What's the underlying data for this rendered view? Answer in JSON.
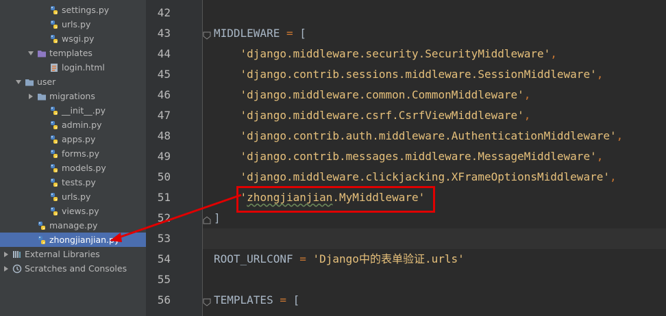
{
  "project_tree": {
    "items": [
      {
        "label": "settings.py",
        "type": "py",
        "indent": 3
      },
      {
        "label": "urls.py",
        "type": "py",
        "indent": 3
      },
      {
        "label": "wsgi.py",
        "type": "py",
        "indent": 3
      },
      {
        "label": "templates",
        "type": "folder-open",
        "indent": 2
      },
      {
        "label": "login.html",
        "type": "html",
        "indent": 3
      },
      {
        "label": "user",
        "type": "folder-open",
        "indent": 1
      },
      {
        "label": "migrations",
        "type": "folder-closed",
        "indent": 2
      },
      {
        "label": "__init__.py",
        "type": "py",
        "indent": 3
      },
      {
        "label": "admin.py",
        "type": "py",
        "indent": 3
      },
      {
        "label": "apps.py",
        "type": "py",
        "indent": 3
      },
      {
        "label": "forms.py",
        "type": "py",
        "indent": 3
      },
      {
        "label": "models.py",
        "type": "py",
        "indent": 3
      },
      {
        "label": "tests.py",
        "type": "py",
        "indent": 3
      },
      {
        "label": "urls.py",
        "type": "py",
        "indent": 3
      },
      {
        "label": "views.py",
        "type": "py",
        "indent": 3
      },
      {
        "label": "manage.py",
        "type": "py",
        "indent": 2
      },
      {
        "label": "zhongjianjian.py",
        "type": "py",
        "indent": 2,
        "selected": true
      },
      {
        "label": "External Libraries",
        "type": "lib",
        "indent": 0
      },
      {
        "label": "Scratches and Consoles",
        "type": "scratch",
        "indent": 0
      }
    ]
  },
  "editor": {
    "lines": [
      {
        "num": "42",
        "parts": []
      },
      {
        "num": "43",
        "parts": [
          {
            "t": "MIDDLEWARE ",
            "c": "id"
          },
          {
            "t": "=",
            "c": "op"
          },
          {
            "t": " [",
            "c": "id"
          }
        ]
      },
      {
        "num": "44",
        "parts": [
          {
            "t": "    'django.middleware.security.SecurityMiddleware'",
            "c": "str"
          },
          {
            "t": ",",
            "c": "op"
          }
        ]
      },
      {
        "num": "45",
        "parts": [
          {
            "t": "    'django.contrib.sessions.middleware.SessionMiddleware'",
            "c": "str"
          },
          {
            "t": ",",
            "c": "op"
          }
        ]
      },
      {
        "num": "46",
        "parts": [
          {
            "t": "    'django.middleware.common.CommonMiddleware'",
            "c": "str"
          },
          {
            "t": ",",
            "c": "op"
          }
        ]
      },
      {
        "num": "47",
        "parts": [
          {
            "t": "    'django.middleware.csrf.CsrfViewMiddleware'",
            "c": "str"
          },
          {
            "t": ",",
            "c": "op"
          }
        ]
      },
      {
        "num": "48",
        "parts": [
          {
            "t": "    'django.contrib.auth.middleware.AuthenticationMiddleware'",
            "c": "str"
          },
          {
            "t": ",",
            "c": "op"
          }
        ]
      },
      {
        "num": "49",
        "parts": [
          {
            "t": "    'django.contrib.messages.middleware.MessageMiddleware'",
            "c": "str"
          },
          {
            "t": ",",
            "c": "op"
          }
        ]
      },
      {
        "num": "50",
        "parts": [
          {
            "t": "    'django.middleware.clickjacking.XFrameOptionsMiddleware'",
            "c": "str"
          },
          {
            "t": ",",
            "c": "op"
          }
        ]
      },
      {
        "num": "51",
        "parts": [
          {
            "t": "    '",
            "c": "str"
          },
          {
            "t": "zhongjianjian",
            "c": "squig"
          },
          {
            "t": ".MyMiddleware'",
            "c": "str"
          }
        ]
      },
      {
        "num": "52",
        "parts": [
          {
            "t": "]",
            "c": "id"
          }
        ]
      },
      {
        "num": "53",
        "parts": []
      },
      {
        "num": "54",
        "parts": [
          {
            "t": "ROOT_URLCONF ",
            "c": "id"
          },
          {
            "t": "=",
            "c": "op"
          },
          {
            "t": " 'Django中的表单验证.urls'",
            "c": "str"
          }
        ]
      },
      {
        "num": "55",
        "parts": []
      },
      {
        "num": "56",
        "parts": [
          {
            "t": "TEMPLATES ",
            "c": "id"
          },
          {
            "t": "=",
            "c": "op"
          },
          {
            "t": " [",
            "c": "id"
          }
        ]
      }
    ]
  },
  "colors": {
    "sidebar_bg": "#3c3f41",
    "editor_bg": "#2b2b2b",
    "selection": "#4b6eaf",
    "string": "#e6c07b",
    "annotation_red": "#e00000"
  }
}
